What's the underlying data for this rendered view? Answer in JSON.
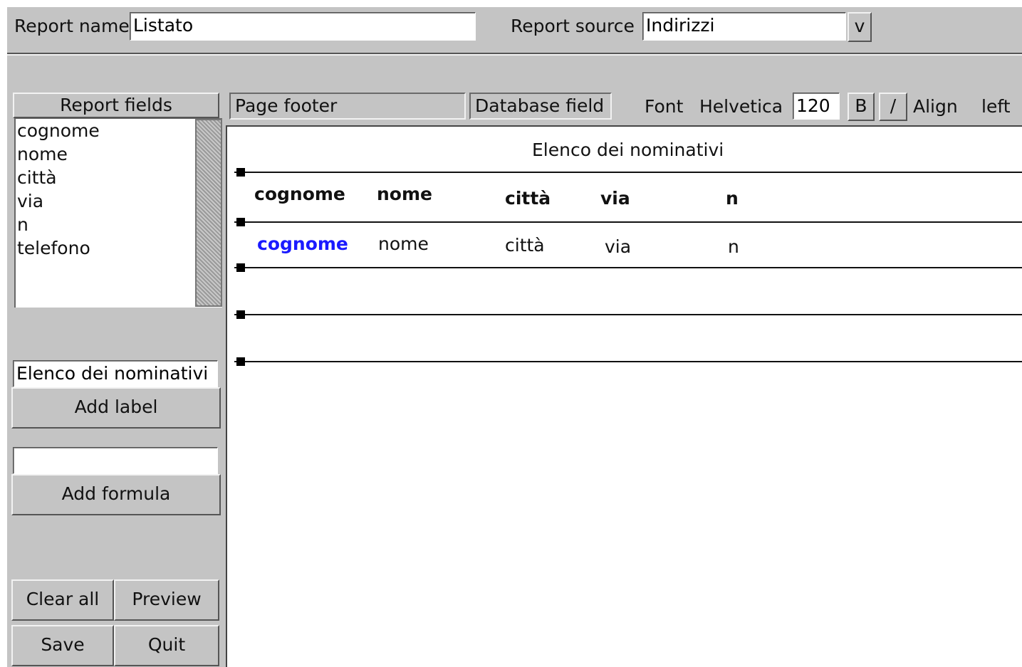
{
  "top": {
    "report_name_label": "Report name",
    "report_name_value": "Listato",
    "report_source_label": "Report source",
    "report_source_value": "Indirizzi",
    "dropdown_glyph": "v"
  },
  "left": {
    "fields_header": "Report fields",
    "fields": [
      "cognome",
      "nome",
      "città",
      "via",
      "n",
      "telefono"
    ],
    "label_input_value": "Elenco dei nominativi",
    "add_label_button": "Add label",
    "formula_input_value": "",
    "add_formula_button": "Add formula",
    "clear_all_button": "Clear all",
    "preview_button": "Preview",
    "save_button": "Save",
    "quit_button": "Quit"
  },
  "toolbar": {
    "section_name": "Page footer",
    "field_type": "Database field",
    "font_label": "Font",
    "font_name": "Helvetica",
    "font_size": "120",
    "bold_button": "B",
    "italic_button": "/",
    "align_label": "Align",
    "align_value": "left"
  },
  "canvas": {
    "title": "Elenco dei nominativi",
    "headers": [
      "cognome",
      "nome",
      "città",
      "via",
      "n"
    ],
    "fields": [
      "cognome",
      "nome",
      "città",
      "via",
      "n"
    ],
    "selected_field_color": "#1a1aff"
  }
}
